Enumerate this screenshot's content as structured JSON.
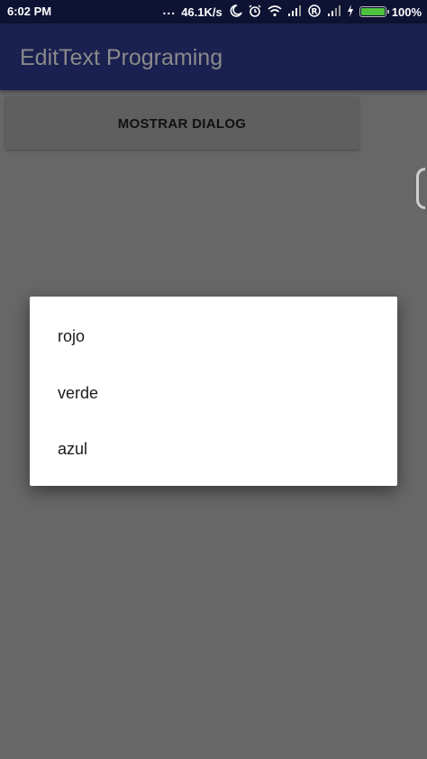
{
  "status_bar": {
    "time": "6:02 PM",
    "dots": "...",
    "speed": "46.1K/s",
    "battery_pct": "100%",
    "icons": [
      "moon-icon",
      "alarm-icon",
      "wifi-icon",
      "signal-icon",
      "registered-icon",
      "signal-icon",
      "charging-icon",
      "battery-icon"
    ]
  },
  "app_bar": {
    "title": "EditText Programing"
  },
  "main": {
    "button_label": "MOSTRAR DIALOG"
  },
  "dialog": {
    "items": [
      "rojo",
      "verde",
      "azul"
    ]
  },
  "colors": {
    "status_bar": "#0e1233",
    "app_bar": "#1a2050",
    "scrim_background": "#676767",
    "dialog": "#ffffff",
    "battery_fill": "#4ec23f"
  }
}
